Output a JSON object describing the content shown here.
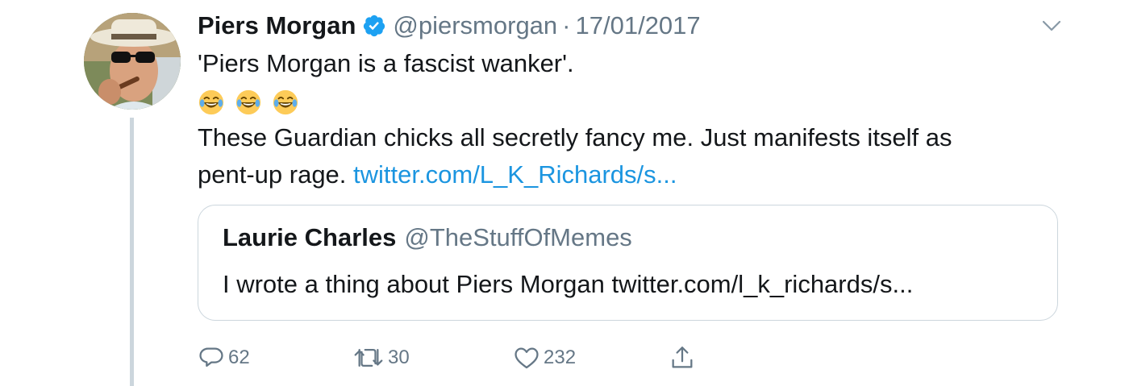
{
  "tweet": {
    "author_name": "Piers Morgan",
    "handle": "@piersmorgan",
    "separator": "·",
    "date": "17/01/2017",
    "text_line1": "'Piers Morgan is a fascist wanker'.",
    "emojis": [
      "face-with-tears-of-joy",
      "face-with-tears-of-joy",
      "face-with-tears-of-joy"
    ],
    "text_line2": "These Guardian chicks all secretly fancy me. Just manifests itself as",
    "text_line3": "pent-up rage.",
    "link_text": "twitter.com/L_K_Richards/s..."
  },
  "quoted_tweet": {
    "author_name": "Laurie Charles",
    "handle": "@TheStuffOfMemes",
    "text": "I wrote a thing about Piers Morgan twitter.com/l_k_richards/s..."
  },
  "actions": {
    "replies": "62",
    "retweets": "30",
    "likes": "232"
  },
  "icons": {
    "verified": "verified-badge-icon",
    "caret": "chevron-down-icon",
    "reply": "reply-icon",
    "retweet": "retweet-icon",
    "like": "heart-icon",
    "share": "share-icon"
  },
  "colors": {
    "text": "#14171a",
    "secondary": "#657786",
    "link": "#1b95e0",
    "verified": "#1da1f2",
    "border": "#ccd6dd"
  }
}
